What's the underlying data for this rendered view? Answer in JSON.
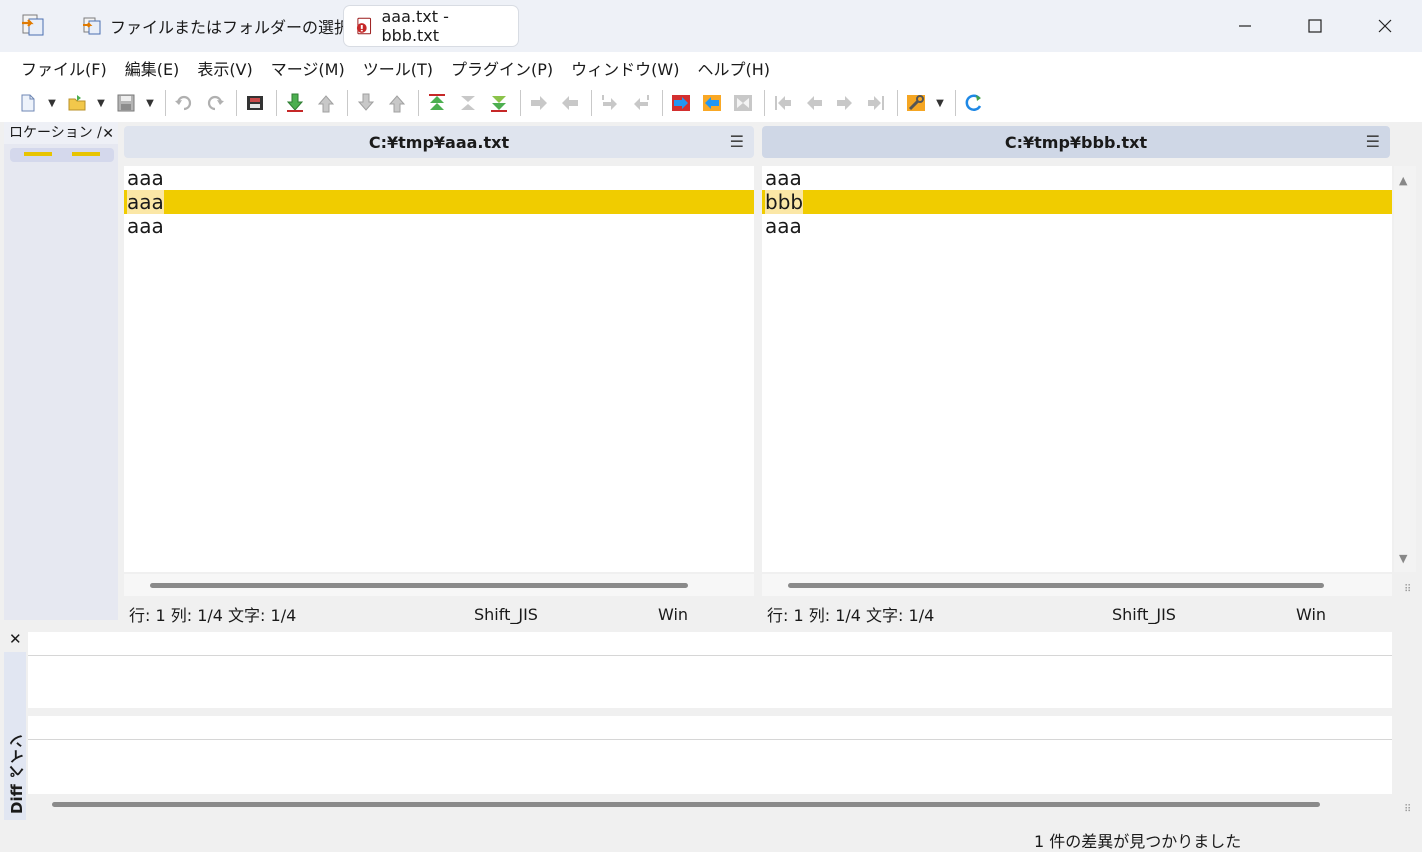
{
  "titlebar": {
    "tab_select": "ファイルまたはフォルダーの選択",
    "tab_compare": "aaa.txt - bbb.txt"
  },
  "menu": [
    "ファイル(F)",
    "編集(E)",
    "表示(V)",
    "マージ(M)",
    "ツール(T)",
    "プラグイン(P)",
    "ウィンドウ(W)",
    "ヘルプ(H)"
  ],
  "location_pane": {
    "title": "ロケーション /"
  },
  "left": {
    "path": "C:¥tmp¥aaa.txt",
    "lines": [
      "aaa",
      "aaa",
      "aaa"
    ],
    "status": {
      "position": "行: 1  列: 1/4  文字: 1/4",
      "encoding": "Shift_JIS",
      "eol": "Win"
    }
  },
  "right": {
    "path": "C:¥tmp¥bbb.txt",
    "lines": [
      "aaa",
      "bbb",
      "aaa"
    ],
    "status": {
      "position": "行: 1  列: 1/4  文字: 1/4",
      "encoding": "Shift_JIS",
      "eol": "Win"
    }
  },
  "diff_pane": {
    "title": "Diff ペイン"
  },
  "statusbar": {
    "message": "1 件の差異が見つかりました"
  },
  "colors": {
    "diff_line": "#f0cc00",
    "diff_word": "#fbe7a6"
  }
}
